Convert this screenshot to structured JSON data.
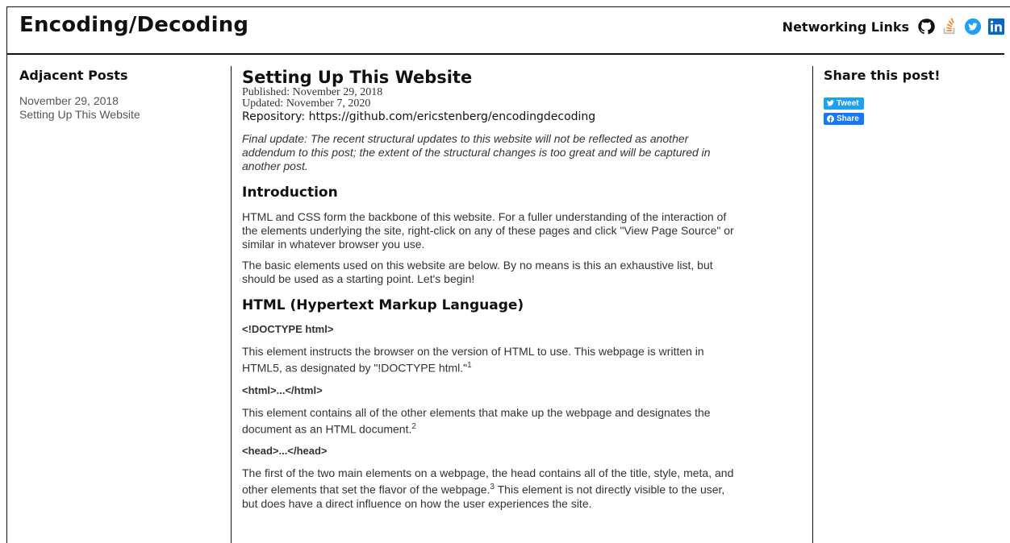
{
  "site": {
    "title": "Encoding/Decoding"
  },
  "networking": {
    "label": "Networking Links",
    "icons": [
      "github-icon",
      "stackoverflow-icon",
      "twitter-icon",
      "linkedin-icon"
    ]
  },
  "left": {
    "heading": "Adjacent Posts",
    "date": "November 29, 2018",
    "link": "Setting Up This Website"
  },
  "post": {
    "title": "Setting Up This Website",
    "published": "Published: November 29, 2018",
    "updated": "Updated: November 7, 2020",
    "repo_label": "Repository: ",
    "repo_url": "https://github.com/ericstenberg/encodingdecoding",
    "final_update": "Final update: The recent structural updates to this website will not be reflected as another addendum to this post; the extent of the structural changes is too great and will be captured in another post.",
    "intro_heading": "Introduction",
    "intro_p1": "HTML and CSS form the backbone of this website. For a fuller understanding of the interaction of the elements underlying the site, right-click on any of these pages and click \"View Page Source\" or similar in whatever browser you use.",
    "intro_p2": "The basic elements used on this website are below. By no means is this an exhaustive list, but should be used as a starting point. Let's begin!",
    "html_heading": "HTML (Hypertext Markup Language)",
    "el1_title": "<!DOCTYPE html>",
    "el1_text": "This element instructs the browser on the version of HTML to use. This webpage is written in HTML5, as designated by \"!DOCTYPE html.\"",
    "el1_sup": "1",
    "el2_title": "<html>...</html>",
    "el2_text": "This element contains all of the other elements that make up the webpage and designates the document as an HTML document.",
    "el2_sup": "2",
    "el3_title": "<head>...</head>",
    "el3_text_a": "The first of the two main elements on a webpage, the head contains all of the title, style, meta, and other elements that set the flavor of the webpage.",
    "el3_sup": "3",
    "el3_text_b": " This element is not directly visible to the user, but does have a direct influence on how the user experiences the site."
  },
  "share": {
    "heading": "Share this post!",
    "tweet_label": "Tweet",
    "share_label": "Share"
  },
  "colors": {
    "twitter": "#1da1f2",
    "facebook": "#1877f2",
    "stackoverflow": "#f48024",
    "linkedin": "#0a66c2"
  }
}
